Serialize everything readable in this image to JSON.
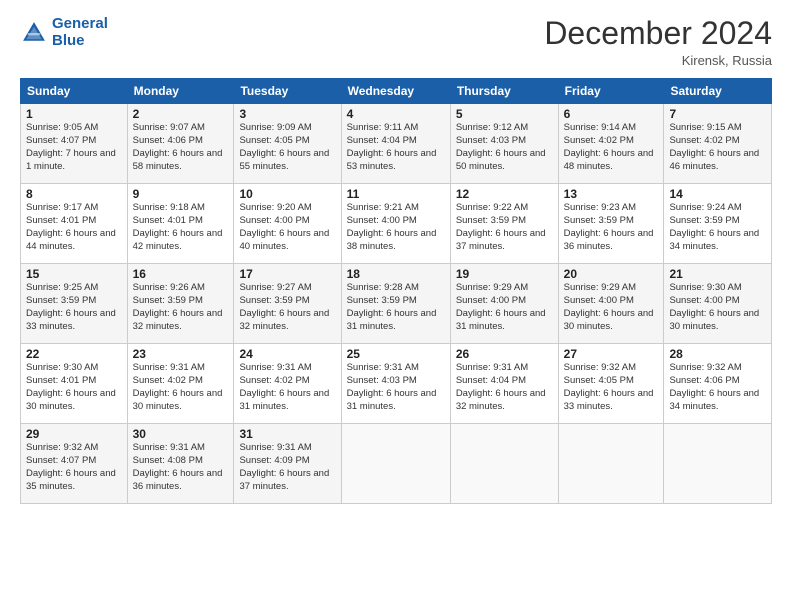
{
  "header": {
    "logo_line1": "General",
    "logo_line2": "Blue",
    "month": "December 2024",
    "location": "Kirensk, Russia"
  },
  "weekdays": [
    "Sunday",
    "Monday",
    "Tuesday",
    "Wednesday",
    "Thursday",
    "Friday",
    "Saturday"
  ],
  "weeks": [
    [
      {
        "day": "1",
        "sunrise": "9:05 AM",
        "sunset": "4:07 PM",
        "daylight": "7 hours and 1 minute."
      },
      {
        "day": "2",
        "sunrise": "9:07 AM",
        "sunset": "4:06 PM",
        "daylight": "6 hours and 58 minutes."
      },
      {
        "day": "3",
        "sunrise": "9:09 AM",
        "sunset": "4:05 PM",
        "daylight": "6 hours and 55 minutes."
      },
      {
        "day": "4",
        "sunrise": "9:11 AM",
        "sunset": "4:04 PM",
        "daylight": "6 hours and 53 minutes."
      },
      {
        "day": "5",
        "sunrise": "9:12 AM",
        "sunset": "4:03 PM",
        "daylight": "6 hours and 50 minutes."
      },
      {
        "day": "6",
        "sunrise": "9:14 AM",
        "sunset": "4:02 PM",
        "daylight": "6 hours and 48 minutes."
      },
      {
        "day": "7",
        "sunrise": "9:15 AM",
        "sunset": "4:02 PM",
        "daylight": "6 hours and 46 minutes."
      }
    ],
    [
      {
        "day": "8",
        "sunrise": "9:17 AM",
        "sunset": "4:01 PM",
        "daylight": "6 hours and 44 minutes."
      },
      {
        "day": "9",
        "sunrise": "9:18 AM",
        "sunset": "4:01 PM",
        "daylight": "6 hours and 42 minutes."
      },
      {
        "day": "10",
        "sunrise": "9:20 AM",
        "sunset": "4:00 PM",
        "daylight": "6 hours and 40 minutes."
      },
      {
        "day": "11",
        "sunrise": "9:21 AM",
        "sunset": "4:00 PM",
        "daylight": "6 hours and 38 minutes."
      },
      {
        "day": "12",
        "sunrise": "9:22 AM",
        "sunset": "3:59 PM",
        "daylight": "6 hours and 37 minutes."
      },
      {
        "day": "13",
        "sunrise": "9:23 AM",
        "sunset": "3:59 PM",
        "daylight": "6 hours and 36 minutes."
      },
      {
        "day": "14",
        "sunrise": "9:24 AM",
        "sunset": "3:59 PM",
        "daylight": "6 hours and 34 minutes."
      }
    ],
    [
      {
        "day": "15",
        "sunrise": "9:25 AM",
        "sunset": "3:59 PM",
        "daylight": "6 hours and 33 minutes."
      },
      {
        "day": "16",
        "sunrise": "9:26 AM",
        "sunset": "3:59 PM",
        "daylight": "6 hours and 32 minutes."
      },
      {
        "day": "17",
        "sunrise": "9:27 AM",
        "sunset": "3:59 PM",
        "daylight": "6 hours and 32 minutes."
      },
      {
        "day": "18",
        "sunrise": "9:28 AM",
        "sunset": "3:59 PM",
        "daylight": "6 hours and 31 minutes."
      },
      {
        "day": "19",
        "sunrise": "9:29 AM",
        "sunset": "4:00 PM",
        "daylight": "6 hours and 31 minutes."
      },
      {
        "day": "20",
        "sunrise": "9:29 AM",
        "sunset": "4:00 PM",
        "daylight": "6 hours and 30 minutes."
      },
      {
        "day": "21",
        "sunrise": "9:30 AM",
        "sunset": "4:00 PM",
        "daylight": "6 hours and 30 minutes."
      }
    ],
    [
      {
        "day": "22",
        "sunrise": "9:30 AM",
        "sunset": "4:01 PM",
        "daylight": "6 hours and 30 minutes."
      },
      {
        "day": "23",
        "sunrise": "9:31 AM",
        "sunset": "4:02 PM",
        "daylight": "6 hours and 30 minutes."
      },
      {
        "day": "24",
        "sunrise": "9:31 AM",
        "sunset": "4:02 PM",
        "daylight": "6 hours and 31 minutes."
      },
      {
        "day": "25",
        "sunrise": "9:31 AM",
        "sunset": "4:03 PM",
        "daylight": "6 hours and 31 minutes."
      },
      {
        "day": "26",
        "sunrise": "9:31 AM",
        "sunset": "4:04 PM",
        "daylight": "6 hours and 32 minutes."
      },
      {
        "day": "27",
        "sunrise": "9:32 AM",
        "sunset": "4:05 PM",
        "daylight": "6 hours and 33 minutes."
      },
      {
        "day": "28",
        "sunrise": "9:32 AM",
        "sunset": "4:06 PM",
        "daylight": "6 hours and 34 minutes."
      }
    ],
    [
      {
        "day": "29",
        "sunrise": "9:32 AM",
        "sunset": "4:07 PM",
        "daylight": "6 hours and 35 minutes."
      },
      {
        "day": "30",
        "sunrise": "9:31 AM",
        "sunset": "4:08 PM",
        "daylight": "6 hours and 36 minutes."
      },
      {
        "day": "31",
        "sunrise": "9:31 AM",
        "sunset": "4:09 PM",
        "daylight": "6 hours and 37 minutes."
      },
      null,
      null,
      null,
      null
    ]
  ]
}
